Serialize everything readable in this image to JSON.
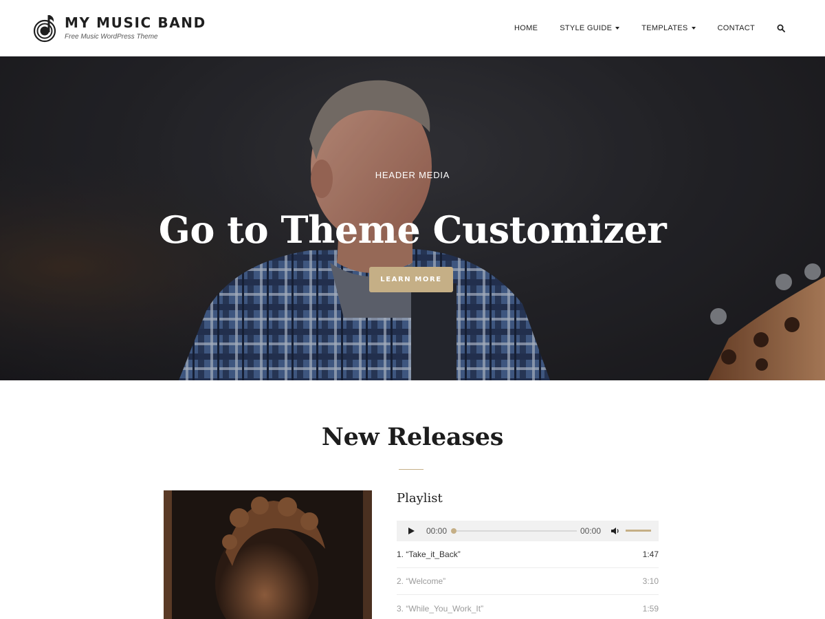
{
  "site": {
    "title": "MY MUSIC BAND",
    "tagline": "Free Music WordPress Theme"
  },
  "nav": {
    "items": [
      {
        "label": "HOME",
        "has_caret": false
      },
      {
        "label": "STYLE GUIDE",
        "has_caret": true
      },
      {
        "label": "TEMPLATES",
        "has_caret": true
      },
      {
        "label": "CONTACT",
        "has_caret": false
      }
    ],
    "search_icon": "search-icon"
  },
  "hero": {
    "eyebrow": "HEADER MEDIA",
    "title": "Go to Theme Customizer",
    "button_label": "LEARN MORE"
  },
  "releases": {
    "title": "New Releases",
    "playlist_title": "Playlist",
    "player": {
      "current_time": "00:00",
      "duration": "00:00",
      "progress": 0,
      "volume": 1.0
    },
    "tracks": [
      {
        "title": "1. “Take_it_Back”",
        "length": "1:47",
        "active": true
      },
      {
        "title": "2. “Welcome”",
        "length": "3:10",
        "active": false
      },
      {
        "title": "3. “While_You_Work_It”",
        "length": "1:59",
        "active": false
      }
    ]
  },
  "colors": {
    "accent": "#c5af86",
    "text_dark": "#1d1d1d",
    "hero_bg": "#2a2a2f"
  }
}
